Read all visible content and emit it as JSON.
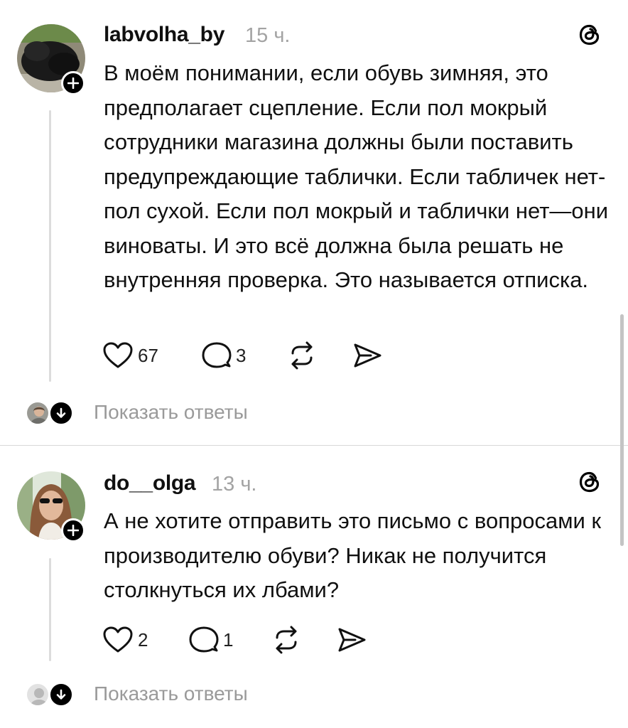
{
  "posts": [
    {
      "username": "labvolha_by",
      "time": "15 ч.",
      "text": "В моём понимании, если обувь зимняя, это предполагает сцепление. Если пол мокрый сотрудники магазина должны были поставить предупреждающие таблички. Если табличек нет-пол сухой. Если пол мокрый и таблички нет—они виноваты. И это всё должна была решать не внутренняя проверка. Это называется отписка.",
      "likes": "67",
      "comments": "3",
      "show_replies": "Показать ответы"
    },
    {
      "username": "do__olga",
      "time": "13 ч.",
      "text": "А не хотите отправить это письмо с вопросами к производителю обуви? Никак не получится столкнуться их лбами?",
      "likes": "2",
      "comments": "1",
      "show_replies": "Показать ответы"
    }
  ],
  "icons": [
    "threads-logo-icon",
    "plus-icon",
    "heart-icon",
    "comment-icon",
    "repost-icon",
    "share-icon",
    "arrow-down-icon"
  ],
  "colors": {
    "text": "#101010",
    "muted": "#a3a3a3",
    "divider": "#d8d8d8",
    "thread_line": "#dcdcdc"
  }
}
